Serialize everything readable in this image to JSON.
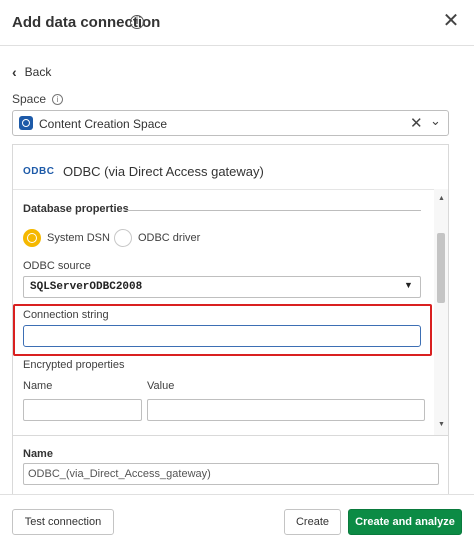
{
  "dialog": {
    "title": "Add data connection",
    "info_glyph": "i",
    "close_glyph": "✕"
  },
  "nav": {
    "back_label": "Back",
    "back_glyph": "‹"
  },
  "space": {
    "label": "Space",
    "info_glyph": "i",
    "selected": "Content Creation Space",
    "clear_glyph": "✕",
    "dropdown_glyph": "⌄"
  },
  "connector": {
    "logo_text": "ODBC",
    "name": "ODBC (via Direct Access gateway)"
  },
  "database_properties": {
    "heading": "Database properties",
    "radio_options": [
      {
        "label": "System DSN",
        "selected": true
      },
      {
        "label": "ODBC driver",
        "selected": false
      }
    ],
    "odbc_source_label": "ODBC source",
    "odbc_source_value": "SQLServerODBC2008",
    "dropdown_glyph": "▼",
    "connection_string_label": "Connection string",
    "connection_string_value": "",
    "encrypted_label": "Encrypted properties",
    "name_col": "Name",
    "value_col": "Value",
    "enc_name_value": "",
    "enc_value_value": ""
  },
  "scrollbar": {
    "up_glyph": "▲",
    "down_glyph": "▼"
  },
  "name_section": {
    "label": "Name",
    "value": "ODBC_(via_Direct_Access_gateway)"
  },
  "footer": {
    "test_label": "Test connection",
    "create_label": "Create",
    "create_analyze_label": "Create and analyze"
  },
  "colors": {
    "accent_green": "#0c8b45",
    "highlight_red": "#d92020",
    "radio_yellow": "#f5b800",
    "brand_blue": "#1d5aa8"
  }
}
